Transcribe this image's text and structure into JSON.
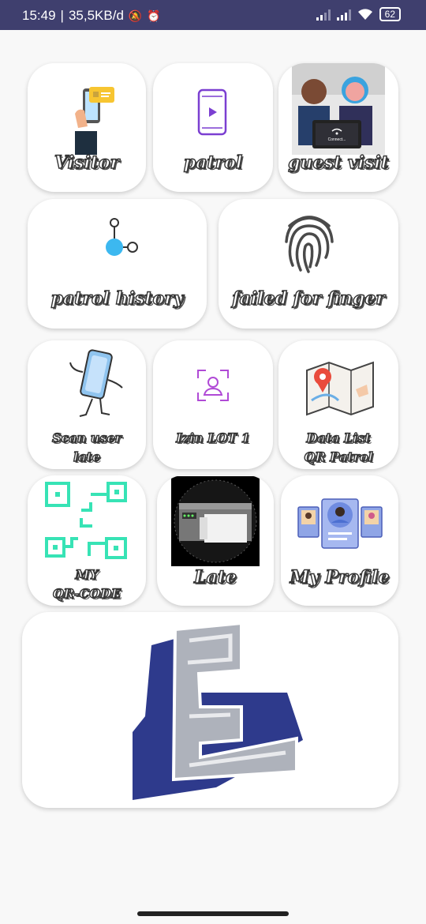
{
  "status": {
    "time": "15:49",
    "speed": "35,5KB/d",
    "battery": "62"
  },
  "menu": {
    "visitor": "Visitor",
    "patrol": "patrol",
    "guest_visit": "guest visit",
    "patrol_history": "patrol history",
    "failed_finger": "failed for finger",
    "scan_user_late_1": "Scan user",
    "scan_user_late_2": "late",
    "izin_lot": "Izin LOT 1",
    "data_list_1": "Data List",
    "data_list_2": "QR Patrol",
    "my_qr_1": "MY",
    "my_qr_2": "QR-CODE",
    "late": "Late",
    "my_profile": "My Profile"
  },
  "guest_visit_screen_text": "Connect...",
  "colors": {
    "statusbar": "#3f3f6e",
    "accent_purple": "#7b3fd1",
    "qr_green": "#37e3b5",
    "logo_blue": "#2e3a8c"
  }
}
